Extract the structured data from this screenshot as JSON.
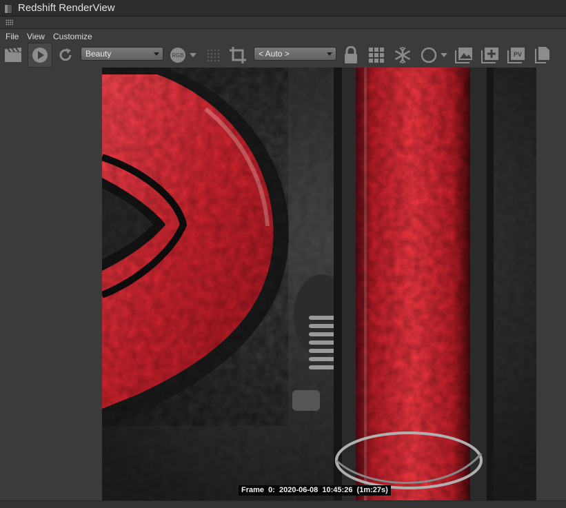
{
  "window": {
    "title": "Redshift RenderView"
  },
  "menu": {
    "file": "File",
    "view": "View",
    "customize": "Customize"
  },
  "toolbar": {
    "aov_selected": "Beauty",
    "rgb_label": "RGB",
    "crop_selected": "< Auto >",
    "pv_label": "PV",
    "icons": [
      "clapperboard-icon",
      "play-icon",
      "refresh-icon",
      "rgb-channel-icon",
      "dropdown-caret-icon",
      "dots-grid-icon",
      "crop-icon",
      "lock-icon",
      "grid-icon",
      "snowflake-icon",
      "circle-icon",
      "dropdown-caret-icon",
      "image-icon",
      "add-image-icon",
      "pv-icon",
      "copy-icon"
    ]
  },
  "status": {
    "frame_info": "Frame  0:  2020-06-08  10:45:26  (1m:27s)"
  },
  "colors": {
    "window_bg": "#3b3b3b",
    "titlebar_bg": "#2d2d2d",
    "render_red": "#e0282f",
    "glass_dark": "#1a1a1a"
  }
}
